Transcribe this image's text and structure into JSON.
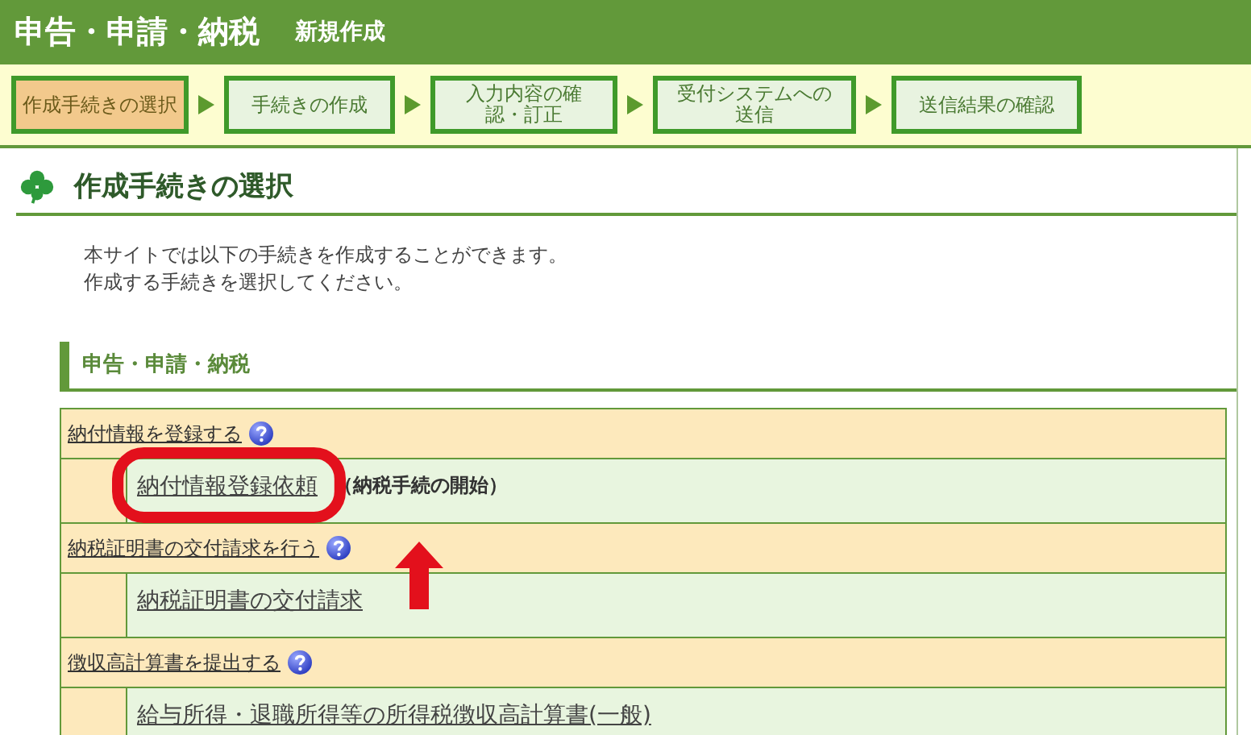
{
  "header": {
    "title": "申告・申請・納税",
    "subtitle": "新規作成"
  },
  "steps": [
    {
      "label": "作成手続きの選択",
      "selected": true
    },
    {
      "label": "手続きの作成",
      "selected": false
    },
    {
      "label": "入力内容の確認・訂正",
      "selected": false
    },
    {
      "label": "受付システムへの送信",
      "selected": false
    },
    {
      "label": "送信結果の確認",
      "selected": false
    }
  ],
  "page_heading": "作成手続きの選択",
  "intro": [
    "本サイトでは以下の手続きを作成することができます。",
    "作成する手続きを選択してください。"
  ],
  "section_heading": "申告・申請・納税",
  "groups": [
    {
      "title": "納付情報を登録する",
      "items": [
        {
          "link": "納付情報登録依頼",
          "note": "（納税手続の開始）",
          "highlighted": true
        }
      ]
    },
    {
      "title": "納税証明書の交付請求を行う",
      "items": [
        {
          "link": "納税証明書の交付請求",
          "highlighted": false
        }
      ]
    },
    {
      "title": "徴収高計算書を提出する",
      "items": [
        {
          "link": "給与所得・退職所得等の所得税徴収高計算書(一般)",
          "highlighted": false
        }
      ]
    }
  ]
}
